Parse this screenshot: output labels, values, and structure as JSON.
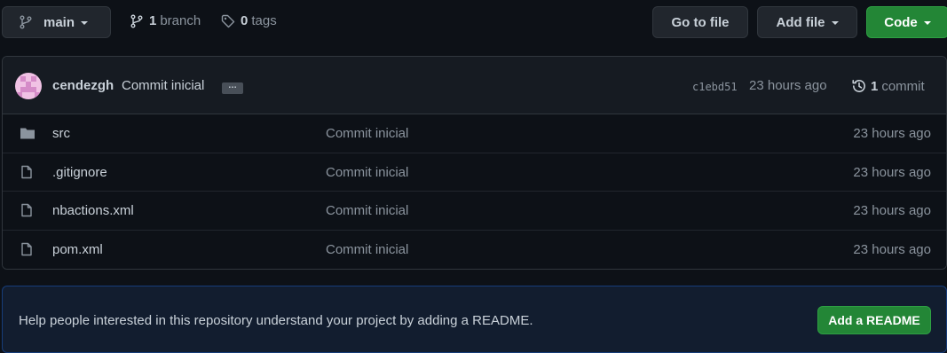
{
  "toolbar": {
    "branch_button": "main",
    "branches_count": "1",
    "branches_label": "branch",
    "tags_count": "0",
    "tags_label": "tags",
    "goto_file": "Go to file",
    "add_file": "Add file",
    "code": "Code"
  },
  "commit": {
    "author": "cendezgh",
    "message": "Commit inicial",
    "ellipsis": "…",
    "sha": "c1ebd51",
    "time": "23 hours ago",
    "count": "1",
    "count_label": "commit"
  },
  "files": [
    {
      "name": "src",
      "type": "folder",
      "commit": "Commit inicial",
      "date": "23 hours ago"
    },
    {
      "name": ".gitignore",
      "type": "file",
      "commit": "Commit inicial",
      "date": "23 hours ago"
    },
    {
      "name": "nbactions.xml",
      "type": "file",
      "commit": "Commit inicial",
      "date": "23 hours ago"
    },
    {
      "name": "pom.xml",
      "type": "file",
      "commit": "Commit inicial",
      "date": "23 hours ago"
    }
  ],
  "readme": {
    "message": "Help people interested in this repository understand your project by adding a README.",
    "button": "Add a README"
  },
  "colors": {
    "background": "#0d1117",
    "primary_button": "#238636",
    "banner": "#121d2f"
  }
}
